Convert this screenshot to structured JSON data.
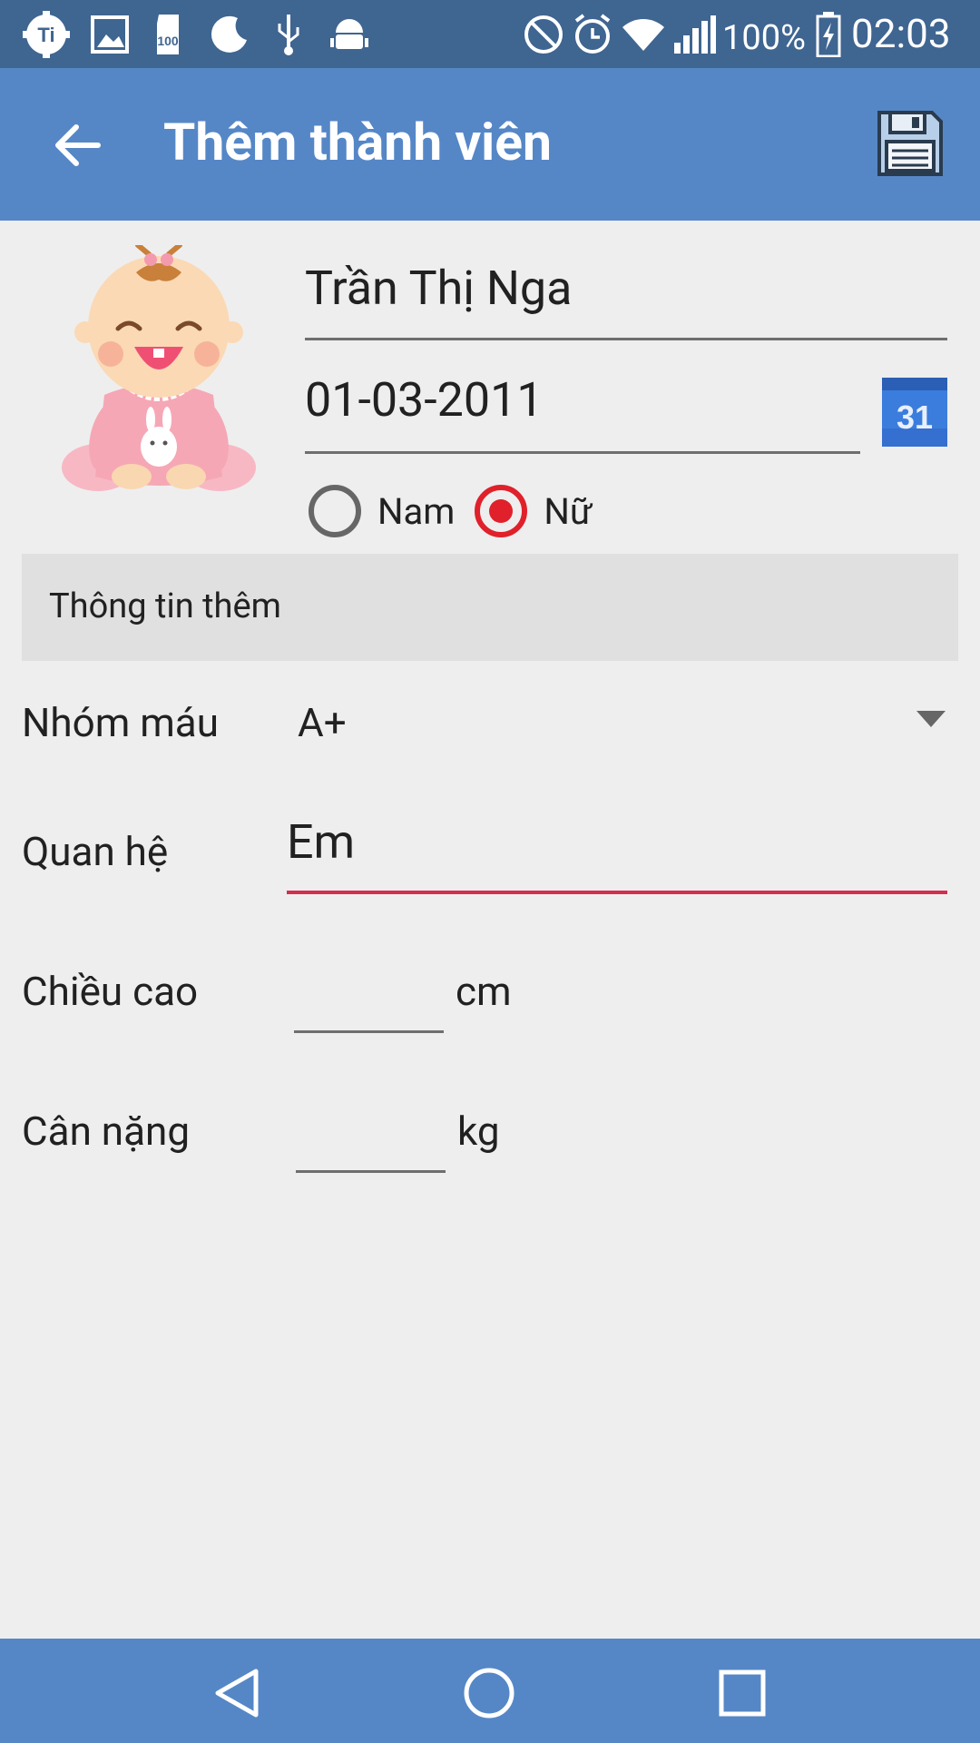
{
  "status_bar": {
    "battery_percent": "100%",
    "time": "02:03",
    "left_icons": [
      "ti-app-icon",
      "image-icon",
      "sd-card-icon",
      "moon-icon",
      "usb-icon",
      "android-debug-icon"
    ],
    "right_icons": [
      "mute-icon",
      "alarm-icon",
      "wifi-icon",
      "signal-icon",
      "battery-charging-icon"
    ]
  },
  "app_bar": {
    "title": "Thêm thành viên"
  },
  "profile": {
    "name": "Trần Thị Nga",
    "birthdate": "01-03-2011",
    "calendar_day": "31",
    "gender_options": [
      {
        "label": "Nam",
        "checked": false
      },
      {
        "label": "Nữ",
        "checked": true
      }
    ]
  },
  "section": {
    "title": "Thông tin thêm"
  },
  "form": {
    "blood_group_label": "Nhóm máu",
    "blood_group_value": "A+",
    "relation_label": "Quan hệ",
    "relation_value": "Em",
    "height_label": "Chiều cao",
    "height_value": "",
    "height_unit": "cm",
    "weight_label": "Cân nặng",
    "weight_value": "",
    "weight_unit": "kg"
  },
  "colors": {
    "status_bar": "#3f6591",
    "app_bar": "#5587c7",
    "nav_bar": "#5587c7",
    "accent": "#e0202a",
    "background": "#eeeeee"
  }
}
